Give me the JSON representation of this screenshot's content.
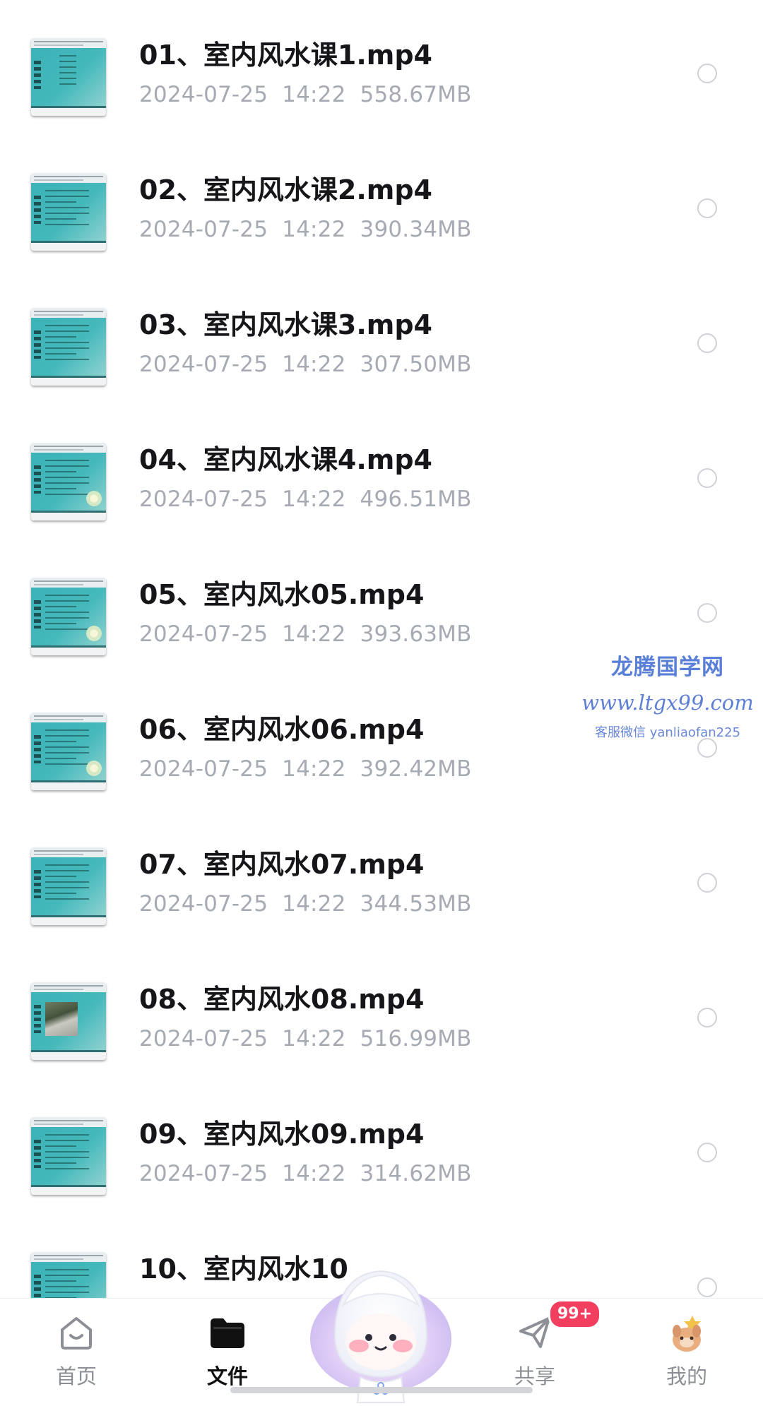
{
  "files": [
    {
      "name": "01、室内风水课1.mp4",
      "date": "2024-07-25",
      "time": "14:22",
      "size": "558.67MB",
      "thumb": "list"
    },
    {
      "name": "02、室内风水课2.mp4",
      "date": "2024-07-25",
      "time": "14:22",
      "size": "390.34MB",
      "thumb": "text"
    },
    {
      "name": "03、室内风水课3.mp4",
      "date": "2024-07-25",
      "time": "14:22",
      "size": "307.50MB",
      "thumb": "text"
    },
    {
      "name": "04、室内风水课4.mp4",
      "date": "2024-07-25",
      "time": "14:22",
      "size": "496.51MB",
      "thumb": "flower"
    },
    {
      "name": "05、室内风水05.mp4",
      "date": "2024-07-25",
      "time": "14:22",
      "size": "393.63MB",
      "thumb": "flower"
    },
    {
      "name": "06、室内风水06.mp4",
      "date": "2024-07-25",
      "time": "14:22",
      "size": "392.42MB",
      "thumb": "flower"
    },
    {
      "name": "07、室内风水07.mp4",
      "date": "2024-07-25",
      "time": "14:22",
      "size": "344.53MB",
      "thumb": "text"
    },
    {
      "name": "08、室内风水08.mp4",
      "date": "2024-07-25",
      "time": "14:22",
      "size": "516.99MB",
      "thumb": "photo"
    },
    {
      "name": "09、室内风水09.mp4",
      "date": "2024-07-25",
      "time": "14:22",
      "size": "314.62MB",
      "thumb": "text"
    },
    {
      "name": "10、室内风水10",
      "date": "",
      "time": "",
      "size": "",
      "thumb": "text"
    }
  ],
  "watermark": {
    "name": "龙腾国学网",
    "url": "www.ltgx99.com",
    "contact": "客服微信 yanliaofan225"
  },
  "nav": {
    "home": "首页",
    "files": "文件",
    "share": "共享",
    "mine": "我的",
    "share_badge": "99+",
    "active": "files"
  },
  "colors": {
    "accent": "#111111",
    "badge": "#f23f5f",
    "watermark": "#5a7fd8",
    "thumb_teal": "#3cb3b8"
  }
}
